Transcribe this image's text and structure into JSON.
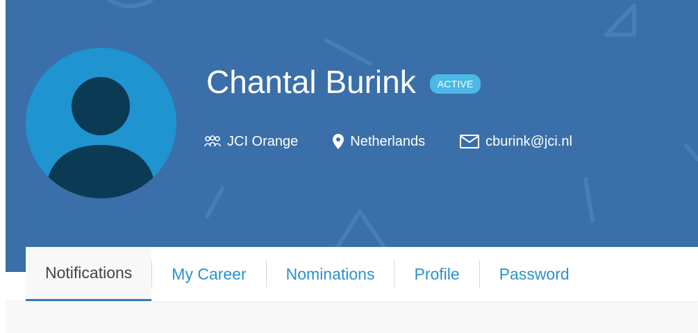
{
  "profile": {
    "name": "Chantal Burink",
    "status_badge": "ACTIVE",
    "organization": "JCI Orange",
    "location": "Netherlands",
    "email": "cburink@jci.nl"
  },
  "icons": {
    "organization": "people-group-icon",
    "location": "map-pin-icon",
    "email": "envelope-icon",
    "avatar": "user-avatar-icon"
  },
  "colors": {
    "header_bg": "#3a6fa9",
    "avatar_bg": "#1f94d0",
    "avatar_figure": "#0b3a55",
    "badge_bg": "#4bb9e5",
    "tab_link": "#2c90cb",
    "tab_active_underline": "#2f7abb"
  },
  "tabs": [
    {
      "label": "Notifications",
      "active": true
    },
    {
      "label": "My Career",
      "active": false
    },
    {
      "label": "Nominations",
      "active": false
    },
    {
      "label": "Profile",
      "active": false
    },
    {
      "label": "Password",
      "active": false
    }
  ]
}
